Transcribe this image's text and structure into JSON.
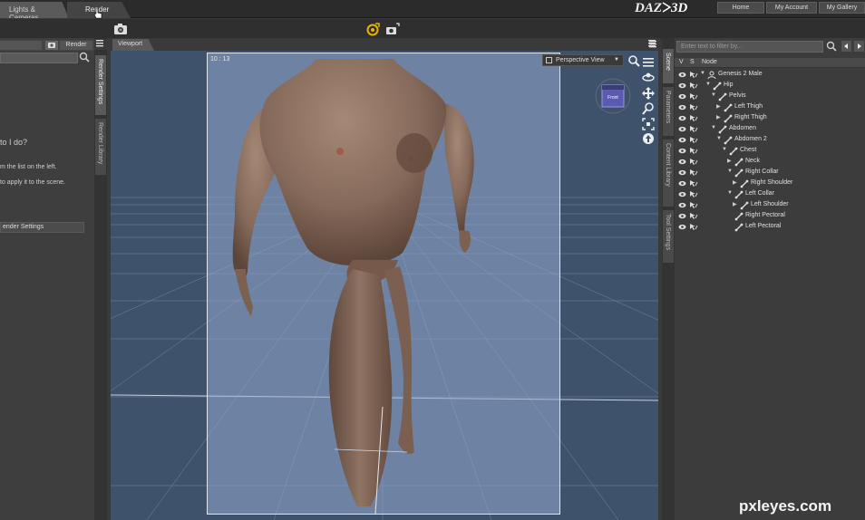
{
  "top_tabs": [
    {
      "label": "Lights & Cameras"
    },
    {
      "label": "Render"
    }
  ],
  "brand": {
    "logo_text_left": "DAZ",
    "logo_text_right": "3D"
  },
  "nav_buttons": [
    {
      "label": "Home"
    },
    {
      "label": "My Account"
    },
    {
      "label": "My Gallery"
    }
  ],
  "left_panel": {
    "render_button": "Render",
    "heading": "to I do?",
    "line1": "m the list on the left.",
    "line2": "to apply it to the scene.",
    "settings_button": "ender Settings"
  },
  "left_vtabs": [
    {
      "label": "Render Settings"
    },
    {
      "label": "Render Library"
    }
  ],
  "viewport": {
    "tab_label": "Viewport",
    "time_readout": "10 : 13",
    "view_mode": "Perspective View",
    "cube_label": "Front"
  },
  "right_vtabs": [
    {
      "label": "Scene"
    },
    {
      "label": "Parameters"
    },
    {
      "label": "Content Library"
    },
    {
      "label": "Tool Settings"
    }
  ],
  "scene": {
    "filter_placeholder": "Enter text to filter by...",
    "columns": {
      "visible": "V",
      "select": "S",
      "node": "Node"
    },
    "nodes": [
      {
        "label": "Genesis 2 Male",
        "depth": 0,
        "expander": "▼"
      },
      {
        "label": "Hip",
        "depth": 1,
        "expander": "▼"
      },
      {
        "label": "Pelvis",
        "depth": 2,
        "expander": "▼"
      },
      {
        "label": "Left Thigh",
        "depth": 3,
        "expander": "▶"
      },
      {
        "label": "Right Thigh",
        "depth": 3,
        "expander": "▶"
      },
      {
        "label": "Abdomen",
        "depth": 2,
        "expander": "▼"
      },
      {
        "label": "Abdomen 2",
        "depth": 3,
        "expander": "▼"
      },
      {
        "label": "Chest",
        "depth": 4,
        "expander": "▼"
      },
      {
        "label": "Neck",
        "depth": 5,
        "expander": "▶"
      },
      {
        "label": "Right Collar",
        "depth": 5,
        "expander": "▼"
      },
      {
        "label": "Right Shoulder",
        "depth": 6,
        "expander": "▶"
      },
      {
        "label": "Left Collar",
        "depth": 5,
        "expander": "▼"
      },
      {
        "label": "Left Shoulder",
        "depth": 6,
        "expander": "▶"
      },
      {
        "label": "Right Pectoral",
        "depth": 5,
        "expander": ""
      },
      {
        "label": "Left Pectoral",
        "depth": 5,
        "expander": ""
      }
    ]
  },
  "watermark": "pxleyes.com",
  "colors": {
    "viewport_bg": "#3f526c",
    "canvas_bg": "#7d93b7",
    "panel_bg": "#3c3c3c",
    "skin": "#8e7462"
  }
}
